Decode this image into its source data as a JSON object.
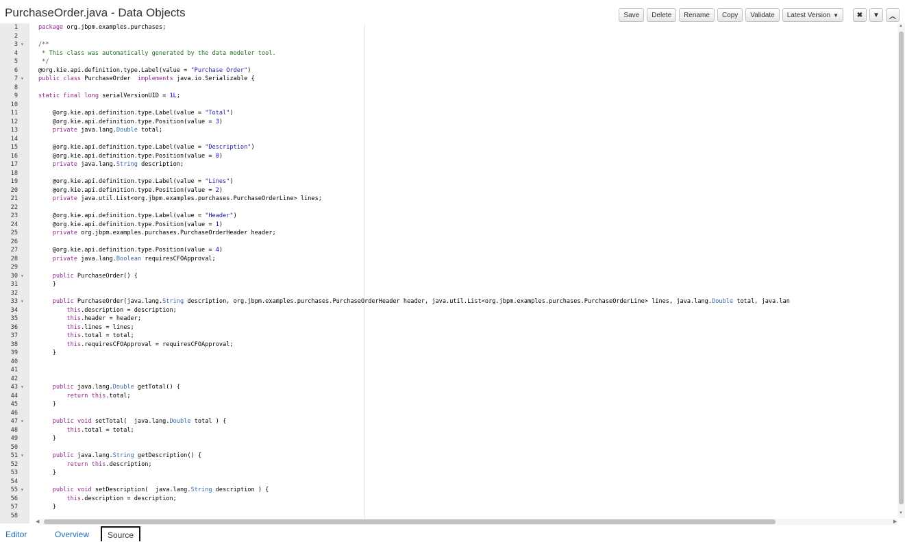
{
  "title": "PurchaseOrder.java - Data Objects",
  "toolbar": {
    "save": "Save",
    "delete": "Delete",
    "rename": "Rename",
    "copy": "Copy",
    "validate": "Validate",
    "latest_version": "Latest Version",
    "close_icon": "close-icon",
    "collapse_icon": "caret-down-icon",
    "maximize_icon": "chevron-up-icon"
  },
  "tabs": {
    "editor": "Editor",
    "overview": "Overview",
    "source": "Source",
    "active": "Source"
  },
  "editor": {
    "lines": [
      {
        "n": "1",
        "fold": false,
        "text": "package org.jbpm.examples.purchases;"
      },
      {
        "n": "2",
        "fold": false,
        "text": ""
      },
      {
        "n": "3",
        "fold": true,
        "text": "/**"
      },
      {
        "n": "4",
        "fold": false,
        "text": " * This class was automatically generated by the data modeler tool."
      },
      {
        "n": "5",
        "fold": false,
        "text": " */"
      },
      {
        "n": "6",
        "fold": false,
        "text": "@org.kie.api.definition.type.Label(value = \"Purchase Order\")"
      },
      {
        "n": "7",
        "fold": true,
        "text": "public class PurchaseOrder  implements java.io.Serializable {"
      },
      {
        "n": "8",
        "fold": false,
        "text": ""
      },
      {
        "n": "9",
        "fold": false,
        "text": "static final long serialVersionUID = 1L;"
      },
      {
        "n": "10",
        "fold": false,
        "text": ""
      },
      {
        "n": "11",
        "fold": false,
        "text": "    @org.kie.api.definition.type.Label(value = \"Total\")"
      },
      {
        "n": "12",
        "fold": false,
        "text": "    @org.kie.api.definition.type.Position(value = 3)"
      },
      {
        "n": "13",
        "fold": false,
        "text": "    private java.lang.Double total;"
      },
      {
        "n": "14",
        "fold": false,
        "text": ""
      },
      {
        "n": "15",
        "fold": false,
        "text": "    @org.kie.api.definition.type.Label(value = \"Description\")"
      },
      {
        "n": "16",
        "fold": false,
        "text": "    @org.kie.api.definition.type.Position(value = 0)"
      },
      {
        "n": "17",
        "fold": false,
        "text": "    private java.lang.String description;"
      },
      {
        "n": "18",
        "fold": false,
        "text": ""
      },
      {
        "n": "19",
        "fold": false,
        "text": "    @org.kie.api.definition.type.Label(value = \"Lines\")"
      },
      {
        "n": "20",
        "fold": false,
        "text": "    @org.kie.api.definition.type.Position(value = 2)"
      },
      {
        "n": "21",
        "fold": false,
        "text": "    private java.util.List<org.jbpm.examples.purchases.PurchaseOrderLine> lines;"
      },
      {
        "n": "22",
        "fold": false,
        "text": ""
      },
      {
        "n": "23",
        "fold": false,
        "text": "    @org.kie.api.definition.type.Label(value = \"Header\")"
      },
      {
        "n": "24",
        "fold": false,
        "text": "    @org.kie.api.definition.type.Position(value = 1)"
      },
      {
        "n": "25",
        "fold": false,
        "text": "    private org.jbpm.examples.purchases.PurchaseOrderHeader header;"
      },
      {
        "n": "26",
        "fold": false,
        "text": ""
      },
      {
        "n": "27",
        "fold": false,
        "text": "    @org.kie.api.definition.type.Position(value = 4)"
      },
      {
        "n": "28",
        "fold": false,
        "text": "    private java.lang.Boolean requiresCFOApproval;"
      },
      {
        "n": "29",
        "fold": false,
        "text": ""
      },
      {
        "n": "30",
        "fold": true,
        "text": "    public PurchaseOrder() {"
      },
      {
        "n": "31",
        "fold": false,
        "text": "    }"
      },
      {
        "n": "32",
        "fold": false,
        "text": ""
      },
      {
        "n": "33",
        "fold": true,
        "text": "    public PurchaseOrder(java.lang.String description, org.jbpm.examples.purchases.PurchaseOrderHeader header, java.util.List<org.jbpm.examples.purchases.PurchaseOrderLine> lines, java.lang.Double total, java.lan"
      },
      {
        "n": "34",
        "fold": false,
        "text": "        this.description = description;"
      },
      {
        "n": "35",
        "fold": false,
        "text": "        this.header = header;"
      },
      {
        "n": "36",
        "fold": false,
        "text": "        this.lines = lines;"
      },
      {
        "n": "37",
        "fold": false,
        "text": "        this.total = total;"
      },
      {
        "n": "38",
        "fold": false,
        "text": "        this.requiresCFOApproval = requiresCFOApproval;"
      },
      {
        "n": "39",
        "fold": false,
        "text": "    }"
      },
      {
        "n": "40",
        "fold": false,
        "text": ""
      },
      {
        "n": "41",
        "fold": false,
        "text": ""
      },
      {
        "n": "42",
        "fold": false,
        "text": ""
      },
      {
        "n": "43",
        "fold": true,
        "text": "    public java.lang.Double getTotal() {"
      },
      {
        "n": "44",
        "fold": false,
        "text": "        return this.total;"
      },
      {
        "n": "45",
        "fold": false,
        "text": "    }"
      },
      {
        "n": "46",
        "fold": false,
        "text": ""
      },
      {
        "n": "47",
        "fold": true,
        "text": "    public void setTotal(  java.lang.Double total ) {"
      },
      {
        "n": "48",
        "fold": false,
        "text": "        this.total = total;"
      },
      {
        "n": "49",
        "fold": false,
        "text": "    }"
      },
      {
        "n": "50",
        "fold": false,
        "text": ""
      },
      {
        "n": "51",
        "fold": true,
        "text": "    public java.lang.String getDescription() {"
      },
      {
        "n": "52",
        "fold": false,
        "text": "        return this.description;"
      },
      {
        "n": "53",
        "fold": false,
        "text": "    }"
      },
      {
        "n": "54",
        "fold": false,
        "text": ""
      },
      {
        "n": "55",
        "fold": true,
        "text": "    public void setDescription(  java.lang.String description ) {"
      },
      {
        "n": "56",
        "fold": false,
        "text": "        this.description = description;"
      },
      {
        "n": "57",
        "fold": false,
        "text": "    }"
      },
      {
        "n": "58",
        "fold": false,
        "text": ""
      }
    ]
  },
  "colors": {
    "keyword": "#93278f",
    "string": "#1a1aa6",
    "comment": "#236e24",
    "type": "#3567a8",
    "number": "#0000cd",
    "link": "#1f6bb8"
  }
}
